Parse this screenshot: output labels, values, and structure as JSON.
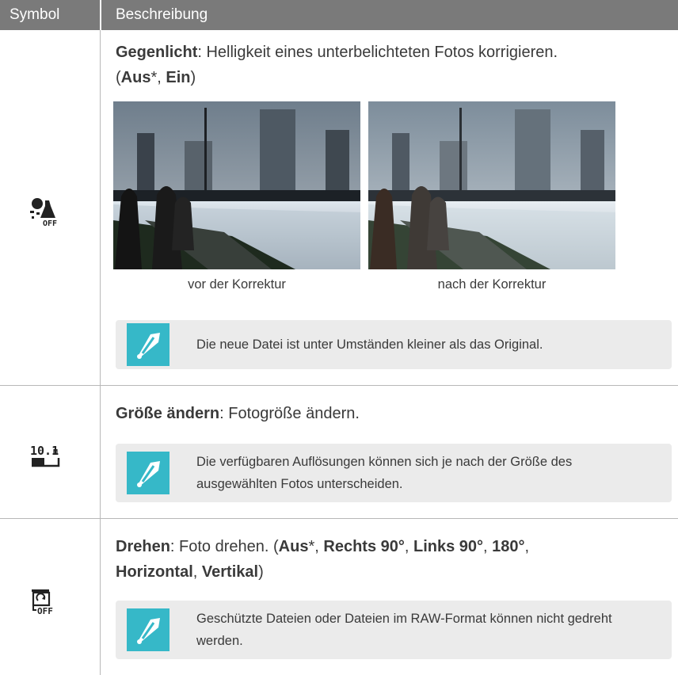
{
  "header": {
    "symbol": "Symbol",
    "description": "Beschreibung"
  },
  "rows": [
    {
      "icon": "backlight-off-icon",
      "title": "Gegenlicht",
      "text": ": Helligkeit eines unterbelichteten Fotos korrigieren.",
      "opt_open": "(",
      "opt1": "Aus",
      "star": "*",
      "comma": ", ",
      "opt2": "Ein",
      "opt_close": ")",
      "images": [
        {
          "caption": "vor der Korrektur"
        },
        {
          "caption": "nach der Korrektur"
        }
      ],
      "note": "Die neue Datei ist unter Umständen kleiner als das Original."
    },
    {
      "icon": "resize-icon",
      "icon_label": "10.1M",
      "title": "Größe ändern",
      "text": ": Fotogröße ändern.",
      "note": "Die verfügbaren Auflösungen können sich je nach der Größe des ausgewählten Fotos unterscheiden."
    },
    {
      "icon": "rotate-off-icon",
      "title": "Drehen",
      "text": ": Foto drehen. (",
      "opt1": "Aus",
      "star": "*",
      "opt2": "Rechts 90°",
      "opt3": "Links 90°",
      "opt4": "180°",
      "opt5": "Horizontal",
      "opt6": "Vertikal",
      "note": "Geschützte Dateien oder Dateien im RAW-Format können nicht gedreht werden."
    }
  ],
  "colors": {
    "header": "#7a7a7a",
    "note_bg": "#ebebeb",
    "note_icon": "#36b8c8"
  }
}
